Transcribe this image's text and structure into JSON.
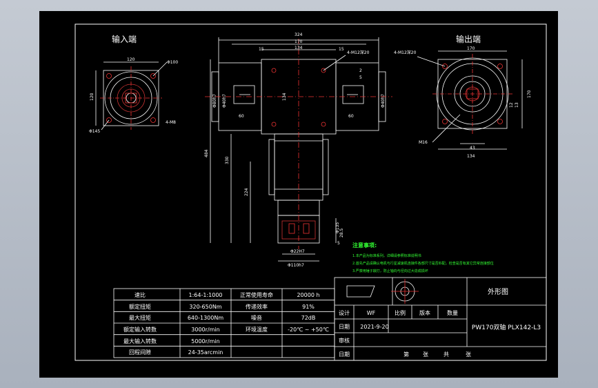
{
  "views": {
    "input_title": "输入端",
    "output_title": "输出端"
  },
  "dims": {
    "in_120": "120",
    "in_phi100": "Φ100",
    "in_phi145": "Φ145",
    "in_holes": "4-M8",
    "in_120_v": "120",
    "front_324": "324",
    "front_170": "170",
    "front_134": "134",
    "front_15a": "15",
    "front_15b": "15",
    "front_holes": "4-M12深20",
    "front_2": "2",
    "front_5": "5",
    "front_134v": "134",
    "front_60": "60",
    "front_phi80": "Φ80h7",
    "front_phi40": "Φ40h7",
    "front_phi40b": "Φ40h7",
    "front_484": "484",
    "front_330": "330",
    "front_224": "224",
    "front_phi135": "Φ135",
    "front_28_5": "28.5",
    "front_5b": "5",
    "front_phi22": "Φ22H7",
    "front_phi110": "Φ110h7",
    "out_170": "170",
    "out_holes": "4-M12深20",
    "out_m16": "M16",
    "out_43": "43",
    "out_134": "134",
    "out_12": "12",
    "out_13": "13",
    "out_170v": "170"
  },
  "notes": {
    "title": "注意事项:",
    "lines": [
      "1.本产品为标准系列，详细请参照标准说明书",
      "2.首先产品请确认电机与行星减速机连接件各部尺寸是否匹配，检查是否有其它异常连接部位",
      "3.严禁用锤子敲打，防止轴向与径向过大造成损坏"
    ]
  },
  "spec_table": {
    "rows": [
      [
        "速比",
        "1:64-1:1000",
        "正常使用寿命",
        "20000 h"
      ],
      [
        "额定扭矩",
        "320-650Nm",
        "传递效率",
        "91%"
      ],
      [
        "最大扭矩",
        "640-1300Nm",
        "噪音",
        "72dB"
      ],
      [
        "额定输入转数",
        "3000r/min",
        "环境温度",
        "-20℃ ~ +50℃"
      ],
      [
        "最大输入转数",
        "5000r/min",
        "",
        ""
      ],
      [
        "回程间隙",
        "24-35arcmin",
        "",
        ""
      ]
    ]
  },
  "title_block": {
    "drawing_title": "外形图",
    "model": "PW170双轴 PLX142-L3",
    "design_label": "设计",
    "designer": "WF",
    "scale_label": "比例",
    "version_label": "版本",
    "qty_label": "数量",
    "date_label": "日期",
    "date_value": "2021-9-20",
    "review_label": "审核",
    "date_label2": "日期",
    "sheet_di": "第",
    "sheet_zhang": "张",
    "sheet_gong": "共",
    "sheet_zhang2": "张"
  }
}
